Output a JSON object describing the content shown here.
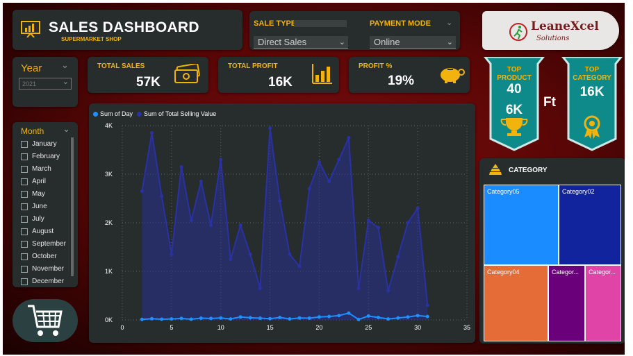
{
  "header": {
    "title": "SALES DASHBOARD",
    "subtitle": "SUPERMARKET SHOP",
    "icon": "chart-presentation-icon"
  },
  "filters": {
    "sale_type_label": "SALE TYPE",
    "sale_type_value": "Direct Sales",
    "payment_mode_label": "PAYMENT MODE",
    "payment_mode_value": "Online",
    "year_label": "Year",
    "year_value": "2021",
    "month_label": "Month",
    "months": [
      "January",
      "February",
      "March",
      "April",
      "May",
      "June",
      "July",
      "August",
      "September",
      "October",
      "November",
      "December"
    ]
  },
  "logo": {
    "name": "LeaneXcel",
    "sub": "Solutions"
  },
  "kpis": {
    "total_sales_label": "TOTAL SALES",
    "total_sales_value": "57K",
    "total_profit_label": "TOTAL PROFIT",
    "total_profit_value": "16K",
    "profit_pct_label": "PROFIT %",
    "profit_pct_value": "19%"
  },
  "badges": {
    "top_product_line1": "TOP",
    "top_product_line2": "PRODUCT",
    "top_product_id": "40",
    "top_product_value": "6K",
    "unit": "Ft",
    "top_category_line1": "TOP",
    "top_category_line2": "CATEGORY",
    "top_category_value": "16K"
  },
  "colors": {
    "accent_gold": "#f2b30c",
    "teal_badge": "#0f8a8a",
    "series_day": "#1e90ff",
    "series_value": "#2a31a6"
  },
  "chart_data": {
    "type": "area",
    "legend": [
      "Sum of Day",
      "Sum of Total Selling Value"
    ],
    "xlim": [
      0,
      35
    ],
    "ylim": [
      0,
      4000
    ],
    "x_ticks": [
      "0",
      "5",
      "10",
      "15",
      "20",
      "25",
      "30",
      "35"
    ],
    "y_ticks": [
      "0K",
      "1K",
      "2K",
      "3K",
      "4K"
    ],
    "series": [
      {
        "name": "Sum of Total Selling Value",
        "x": [
          2,
          3,
          4,
          5,
          6,
          7,
          8,
          9,
          10,
          11,
          12,
          13,
          14,
          15,
          16,
          17,
          18,
          19,
          20,
          21,
          22,
          23,
          24,
          25,
          26,
          27,
          28,
          29,
          30,
          31
        ],
        "values": [
          2650,
          3850,
          2550,
          1350,
          3150,
          2050,
          2850,
          1950,
          3300,
          1250,
          1950,
          1350,
          650,
          3950,
          2450,
          1350,
          1100,
          2700,
          3250,
          2850,
          3300,
          3750,
          650,
          2050,
          1900,
          600,
          1300,
          2000,
          2300,
          300
        ]
      },
      {
        "name": "Sum of Day",
        "x": [
          2,
          3,
          4,
          5,
          6,
          7,
          8,
          9,
          10,
          11,
          12,
          13,
          14,
          15,
          16,
          17,
          18,
          19,
          20,
          21,
          22,
          23,
          24,
          25,
          26,
          27,
          28,
          29,
          30,
          31
        ],
        "values": [
          10,
          25,
          15,
          20,
          30,
          15,
          35,
          30,
          40,
          20,
          60,
          45,
          35,
          25,
          50,
          20,
          40,
          35,
          60,
          70,
          90,
          140,
          10,
          80,
          50,
          20,
          40,
          60,
          90,
          70
        ]
      }
    ]
  },
  "treemap": {
    "title": "CATEGORY",
    "cells": [
      {
        "label": "Category05",
        "color": "#1a8cff"
      },
      {
        "label": "Category02",
        "color": "#12239e"
      },
      {
        "label": "Category04",
        "color": "#e66c37"
      },
      {
        "label": "Categor...",
        "color": "#6b007b"
      },
      {
        "label": "Categor...",
        "color": "#e044a7"
      }
    ]
  }
}
